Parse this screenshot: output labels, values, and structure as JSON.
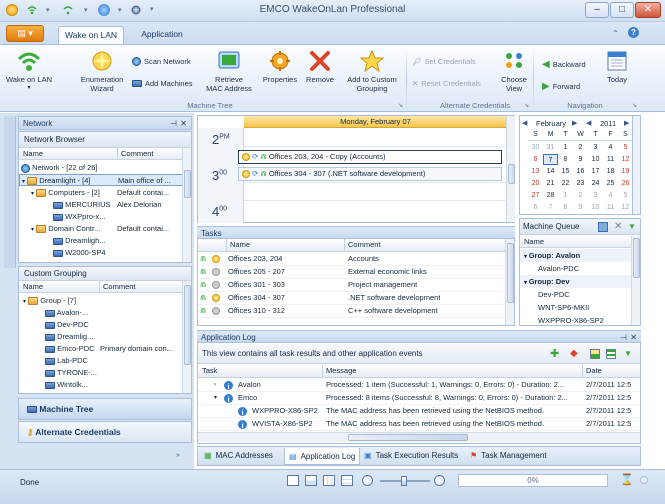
{
  "window": {
    "title": "EMCO WakeOnLan Professional",
    "minimize": "–",
    "maximize": "□",
    "close": "✕"
  },
  "tabs": [
    {
      "label": "Wake on LAN"
    },
    {
      "label": "Application"
    }
  ],
  "ribbon": {
    "wake_on_lan": "Wake on LAN",
    "enumeration": "Enumeration",
    "wizard": "Wizard",
    "scan_network": "Scan Network",
    "add_machines": "Add Machines",
    "retrieve": "Retrieve",
    "mac_address": "MAC Address",
    "properties": "Properties",
    "remove": "Remove",
    "add_custom": "Add to Custom",
    "grouping": "Grouping",
    "machine_tree_group": "Machine Tree",
    "set_credentials": "Set Credentials",
    "reset_credentials": "Reset Credentials",
    "alt_cred_group": "Alternate Credentials",
    "choose": "Choose",
    "view": "View",
    "backward": "Backward",
    "forward": "Forward",
    "today": "Today",
    "navigation_group": "Navigation"
  },
  "network_panel": {
    "title": "Network",
    "browser_title": "Network Browser",
    "col_name": "Name",
    "col_comment": "Comment",
    "rows": [
      {
        "name": "Network - [22 of 26]",
        "comment": ""
      },
      {
        "name": "Dreamlight - [4]",
        "comment": "Main office of ..."
      },
      {
        "name": "Computers - [2]",
        "comment": "Default contai..."
      },
      {
        "name": "MERCURIUS",
        "comment": "Alex Delorian"
      },
      {
        "name": "WXPpro-x...",
        "comment": ""
      },
      {
        "name": "Domain Contr...",
        "comment": "Default contai..."
      },
      {
        "name": "Dreamligh...",
        "comment": ""
      },
      {
        "name": "W2000-SP4",
        "comment": ""
      }
    ]
  },
  "custom_grouping": {
    "title": "Custom Grouping",
    "col_name": "Name",
    "col_comment": "Comment",
    "rows": [
      {
        "name": "Group - [7]",
        "comment": ""
      },
      {
        "name": "Avalon-...",
        "comment": ""
      },
      {
        "name": "Dev-PDC",
        "comment": ""
      },
      {
        "name": "Dreamlig...",
        "comment": ""
      },
      {
        "name": "Emco-PDC",
        "comment": "Primary domain con..."
      },
      {
        "name": "Lab-PDC",
        "comment": ""
      },
      {
        "name": "TYRONE-...",
        "comment": ""
      },
      {
        "name": "Wintolk...",
        "comment": ""
      }
    ]
  },
  "nav_buttons": {
    "machine_tree": "Machine Tree",
    "alt_credentials": "Alternate Credentials"
  },
  "calendar": {
    "date_header": "Monday, February 07",
    "times": [
      {
        "hour": "2",
        "suffix": "PM"
      },
      {
        "hour": "3",
        "suffix": "00"
      },
      {
        "hour": "4",
        "suffix": "00"
      }
    ],
    "appointments": [
      "Offices 203, 204 - Copy (Accounts)",
      "Offices 304 - 307 (.NET software development)"
    ]
  },
  "tasks": {
    "title": "Tasks",
    "col_name": "Name",
    "col_comment": "Comment",
    "rows": [
      {
        "name": "Offices 203, 204",
        "comment": "Accounts"
      },
      {
        "name": "Offices 205 - 207",
        "comment": "External economic links"
      },
      {
        "name": "Offices 301 - 303",
        "comment": "Project management"
      },
      {
        "name": "Offices 304 - 307",
        "comment": ".NET software development"
      },
      {
        "name": "Offices 310 - 312",
        "comment": "C++ software development"
      }
    ]
  },
  "mini_calendar": {
    "month": "February",
    "year": "2011",
    "days": [
      "S",
      "M",
      "T",
      "W",
      "T",
      "F",
      "S"
    ],
    "weeks": [
      [
        "30",
        "31",
        "1",
        "2",
        "3",
        "4",
        "5"
      ],
      [
        "6",
        "7",
        "8",
        "9",
        "10",
        "11",
        "12"
      ],
      [
        "13",
        "14",
        "15",
        "16",
        "17",
        "18",
        "19"
      ],
      [
        "20",
        "21",
        "22",
        "23",
        "24",
        "25",
        "26"
      ],
      [
        "27",
        "28",
        "1",
        "2",
        "3",
        "4",
        "5"
      ],
      [
        "6",
        "7",
        "8",
        "9",
        "10",
        "11",
        "12"
      ]
    ]
  },
  "machine_queue": {
    "title": "Machine Queue",
    "col_name": "Name",
    "rows": [
      {
        "text": "Group: Avalon",
        "group": true
      },
      {
        "text": "Avalon-PDC",
        "group": false
      },
      {
        "text": "Group: Dev",
        "group": true
      },
      {
        "text": "Dev-PDC",
        "group": false
      },
      {
        "text": "WNT-SP6-MKII",
        "group": false
      },
      {
        "text": "WXPPRO-X86-SP2",
        "group": false
      }
    ]
  },
  "app_log": {
    "title": "Application Log",
    "description": "This view contains all task results and other application events",
    "col_task": "Task",
    "col_message": "Message",
    "col_date": "Date",
    "rows": [
      {
        "task": "Avalon",
        "message": "Processed: 1 item (Successful: 1, Warnings: 0, Errors: 0) - Duration: 2...",
        "date": "2/7/2011 12:5"
      },
      {
        "task": "Emco",
        "message": "Processed: 8 items (Successful: 8, Warnings: 0, Errors: 0) - Duration: 2...",
        "date": "2/7/2011 12:5"
      },
      {
        "task": "WXPPRO-X86-SP2",
        "message": "The MAC address has been retrieved using the NetBIOS method.",
        "date": "2/7/2011 12:5"
      },
      {
        "task": "WVISTA-X86-SP2",
        "message": "The MAC address has been retrieved using the NetBIOS method.",
        "date": "2/7/2011 12:5"
      }
    ]
  },
  "bottom_tabs": [
    "MAC Addresses",
    "Application Log",
    "Task Execution Results",
    "Task Management"
  ],
  "status": {
    "text": "Done",
    "progress": "0%"
  }
}
